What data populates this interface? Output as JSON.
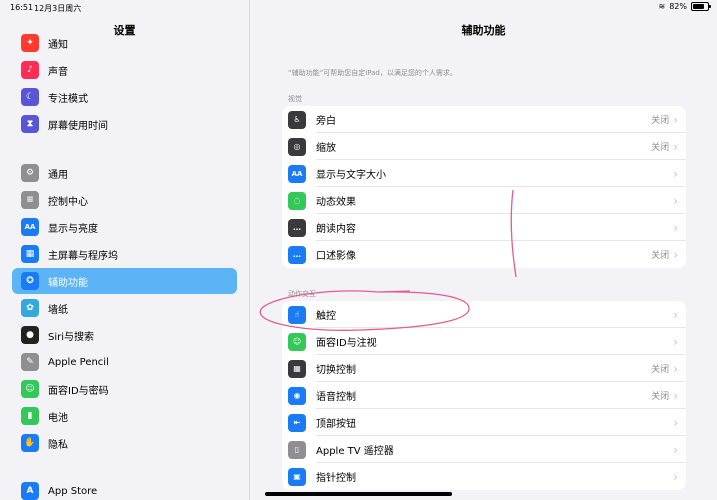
{
  "status": {
    "time": "16:51",
    "date": "12月3日周六",
    "battery": "82%",
    "battery_level": 0.82
  },
  "sidebar": {
    "title": "设置",
    "groups": [
      [
        {
          "label": "通知",
          "icon": "bell-icon",
          "color": "#ff3b30",
          "glyph": "✦"
        },
        {
          "label": "声音",
          "icon": "speaker-icon",
          "color": "#ff2d55",
          "glyph": "♪"
        },
        {
          "label": "专注模式",
          "icon": "moon-icon",
          "color": "#5856d6",
          "glyph": "☾"
        },
        {
          "label": "屏幕使用时间",
          "icon": "hourglass-icon",
          "color": "#5856d6",
          "glyph": "⧗"
        }
      ],
      [
        {
          "label": "通用",
          "icon": "gear-icon",
          "color": "#8e8e93",
          "glyph": "⚙"
        },
        {
          "label": "控制中心",
          "icon": "switches-icon",
          "color": "#8e8e93",
          "glyph": "≡"
        },
        {
          "label": "显示与亮度",
          "icon": "text-size-icon",
          "color": "#1a7cf5",
          "glyph": "AA"
        },
        {
          "label": "主屏幕与程序坞",
          "icon": "grid-icon",
          "color": "#1a7cf5",
          "glyph": "▦"
        },
        {
          "label": "辅助功能",
          "icon": "accessibility-icon",
          "color": "#1a7cf5",
          "glyph": "✪",
          "active": true
        },
        {
          "label": "墙纸",
          "icon": "flower-icon",
          "color": "#34aadc",
          "glyph": "✿"
        },
        {
          "label": "Siri与搜索",
          "icon": "siri-icon",
          "color": "#222222",
          "glyph": "●"
        },
        {
          "label": "Apple Pencil",
          "icon": "pencil-icon",
          "color": "#8e8e93",
          "glyph": "✎"
        },
        {
          "label": "面容ID与密码",
          "icon": "face-id-icon",
          "color": "#34c759",
          "glyph": "☺"
        },
        {
          "label": "电池",
          "icon": "battery-icon",
          "color": "#34c759",
          "glyph": "▮"
        },
        {
          "label": "隐私",
          "icon": "hand-icon",
          "color": "#1a7cf5",
          "glyph": "✋"
        }
      ],
      [
        {
          "label": "App Store",
          "icon": "app-store-icon",
          "color": "#1a7cf5",
          "glyph": "A"
        }
      ]
    ]
  },
  "main": {
    "title": "辅助功能",
    "description": "“辅助功能”可帮助您自定iPad，以满足您的个人需求。",
    "sections": [
      {
        "header": "视觉",
        "rows": [
          {
            "label": "旁白",
            "value": "关闭",
            "icon": "voiceover-icon",
            "color": "#3a3a3c",
            "glyph": "♿"
          },
          {
            "label": "缩放",
            "value": "关闭",
            "icon": "zoom-icon",
            "color": "#3a3a3c",
            "glyph": "◎"
          },
          {
            "label": "显示与文字大小",
            "value": "",
            "icon": "text-size-icon",
            "color": "#1a7cf5",
            "glyph": "AA"
          },
          {
            "label": "动态效果",
            "value": "",
            "icon": "motion-icon",
            "color": "#34c759",
            "glyph": "◌"
          },
          {
            "label": "朗读内容",
            "value": "",
            "icon": "speech-bubble-icon",
            "color": "#3a3a3c",
            "glyph": "…"
          },
          {
            "label": "口述影像",
            "value": "关闭",
            "icon": "audio-description-icon",
            "color": "#1a7cf5",
            "glyph": "…"
          }
        ]
      },
      {
        "header": "动作交互",
        "rows": [
          {
            "label": "触控",
            "value": "",
            "icon": "touch-icon",
            "color": "#1a7cf5",
            "glyph": "☝"
          },
          {
            "label": "面容ID与注视",
            "value": "",
            "icon": "face-id-icon",
            "color": "#34c759",
            "glyph": "☺"
          },
          {
            "label": "切换控制",
            "value": "关闭",
            "icon": "switch-control-icon",
            "color": "#3a3a3c",
            "glyph": "▦"
          },
          {
            "label": "语音控制",
            "value": "关闭",
            "icon": "voice-control-icon",
            "color": "#1a7cf5",
            "glyph": "◉"
          },
          {
            "label": "顶部按钮",
            "value": "",
            "icon": "top-button-icon",
            "color": "#1a7cf5",
            "glyph": "⇤"
          },
          {
            "label": "Apple TV 遥控器",
            "value": "",
            "icon": "remote-icon",
            "color": "#8e8e93",
            "glyph": "▯"
          },
          {
            "label": "指针控制",
            "value": "",
            "icon": "pointer-icon",
            "color": "#1a7cf5",
            "glyph": "▣"
          }
        ]
      }
    ]
  }
}
